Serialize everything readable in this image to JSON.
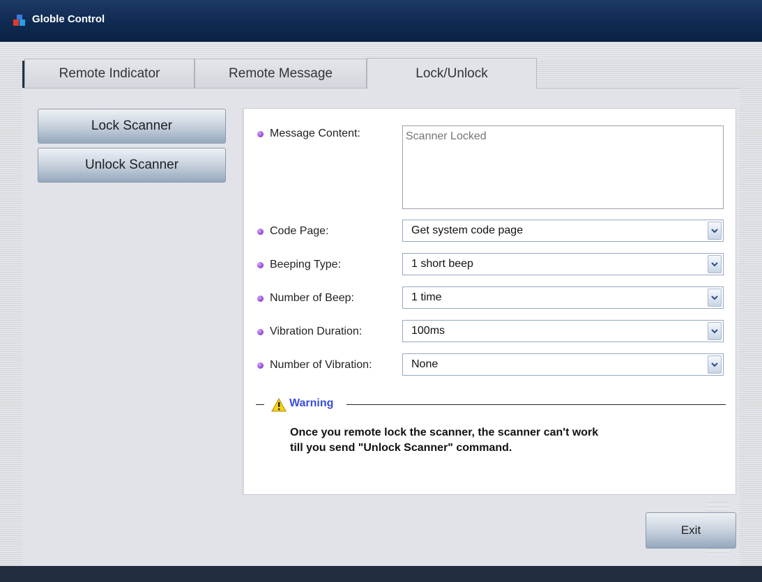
{
  "window": {
    "title": "Globle Control",
    "logo_icon": "app-logo-icon"
  },
  "tabs": [
    {
      "label": "Remote Indicator",
      "active": false
    },
    {
      "label": "Remote Message",
      "active": false
    },
    {
      "label": "Lock/Unlock",
      "active": true
    }
  ],
  "actions": {
    "lock_label": "Lock Scanner",
    "unlock_label": "Unlock Scanner",
    "exit_label": "Exit"
  },
  "form": {
    "message_content": {
      "label": "Message Content:",
      "placeholder": "Scanner Locked"
    },
    "code_page": {
      "label": "Code Page:",
      "value": "Get system code page"
    },
    "beeping_type": {
      "label": "Beeping Type:",
      "value": "1 short beep"
    },
    "number_of_beep": {
      "label": "Number of Beep:",
      "value": "1 time"
    },
    "vibration_duration": {
      "label": "Vibration Duration:",
      "value": "100ms"
    },
    "number_of_vibration": {
      "label": "Number of Vibration:",
      "value": "None"
    }
  },
  "warning": {
    "title": "Warning",
    "line1": "Once you remote lock the scanner, the scanner can't work",
    "line2": "till you send \"Unlock Scanner\" command.",
    "icon": "warning-triangle-icon"
  },
  "colors": {
    "titlebar": "#0f2a52",
    "bullet": "#8a3fcf",
    "warning_title": "#3a4de0"
  }
}
